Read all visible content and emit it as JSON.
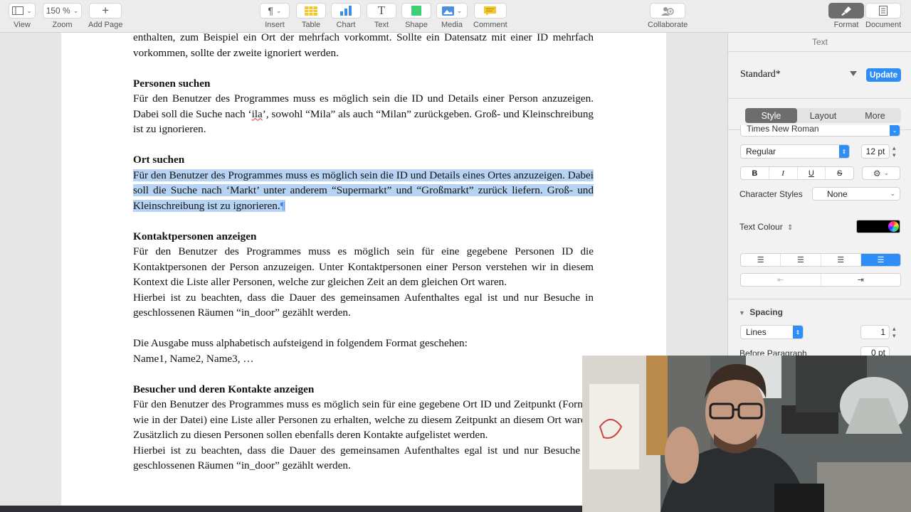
{
  "toolbar": {
    "view": "View",
    "zoom_value": "150 %",
    "zoom": "Zoom",
    "add_page": "Add Page",
    "insert": "Insert",
    "table": "Table",
    "chart": "Chart",
    "text": "Text",
    "shape": "Shape",
    "media": "Media",
    "comment": "Comment",
    "collaborate": "Collaborate",
    "format": "Format",
    "document": "Document"
  },
  "document": {
    "p_intro_1": "enthalten, zum Beispiel ein Ort der mehrfach vorkommt. Sollte ein Datensatz mit einer ID mehrfach vorkommen, sollte der zweite ignoriert werden.",
    "h_personen": "Personen suchen",
    "p_personen_a": "Für den Benutzer des Programmes muss es möglich sein die ID und Details einer Person anzuzeigen. Dabei soll die Suche nach ‘",
    "p_personen_ila": "ila",
    "p_personen_b": "’, sowohl “Mila” als auch “Milan” zurückgeben. Groß- und Kleinschreibung ist zu ignorieren.",
    "h_ort": "Ort suchen",
    "p_ort": "Für den Benutzer des Programmes muss es möglich sein die ID und Details eines Ortes anzuzeigen. Dabei soll die Suche nach ‘Markt’ unter anderem “Supermarkt” und “Großmarkt” zurück liefern. Groß- und Kleinschreibung ist zu ignorieren.",
    "pilcrow": "¶",
    "h_kontakt": "Kontaktpersonen anzeigen",
    "p_kontakt_1": "Für den Benutzer des Programmes muss es möglich sein für eine gegebene Personen ID die Kontaktpersonen der Person anzuzeigen. Unter Kontaktpersonen einer Person verstehen wir in diesem Kontext die Liste aller Personen, welche zur gleichen Zeit an dem gleichen Ort waren.",
    "p_kontakt_2": "Hierbei ist zu beachten, dass die Dauer des gemeinsamen Aufenthaltes egal ist und nur Besuche in geschlossenen Räumen “in_door” gezählt werden.",
    "p_ausgabe_1": "Die Ausgabe muss alphabetisch aufsteigend in folgendem Format geschehen:",
    "p_ausgabe_2": "Name1, Name2, Name3, …",
    "h_besucher": "Besucher und deren Kontakte anzeigen",
    "p_besucher_1": "Für den Benutzer des Programmes muss es möglich sein für eine gegebene Ort ID und Zeitpunkt (Format wie in der Datei) eine Liste aller Personen zu erhalten, welche zu diesem Zeitpunkt an diesem Ort waren. Zusätzlich zu diesen Personen sollen ebenfalls deren Kontakte aufgelistet werden.",
    "p_besucher_2": "Hierbei ist zu beachten, dass die Dauer des gemeinsamen Aufenthaltes egal ist und nur Besuche in geschlossenen Räumen “in_door” gezählt werden."
  },
  "inspector": {
    "title": "Text",
    "style_name": "Standard*",
    "update": "Update",
    "tabs": [
      "Style",
      "Layout",
      "More"
    ],
    "font_family": "Times New Roman",
    "font_style": "Regular",
    "font_size": "12 pt",
    "bold": "B",
    "italic": "I",
    "underline": "U",
    "strike": "S",
    "char_styles_label": "Character Styles",
    "char_styles_value": "None",
    "text_colour_label": "Text Colour",
    "text_colour": "#000000",
    "spacing_label": "Spacing",
    "spacing_mode": "Lines",
    "spacing_value": "1",
    "before_para_label": "Before Paragraph",
    "before_para_value": "0 pt"
  },
  "colors": {
    "accent": "#2f8ef5",
    "selection": "#b7d3f3"
  }
}
